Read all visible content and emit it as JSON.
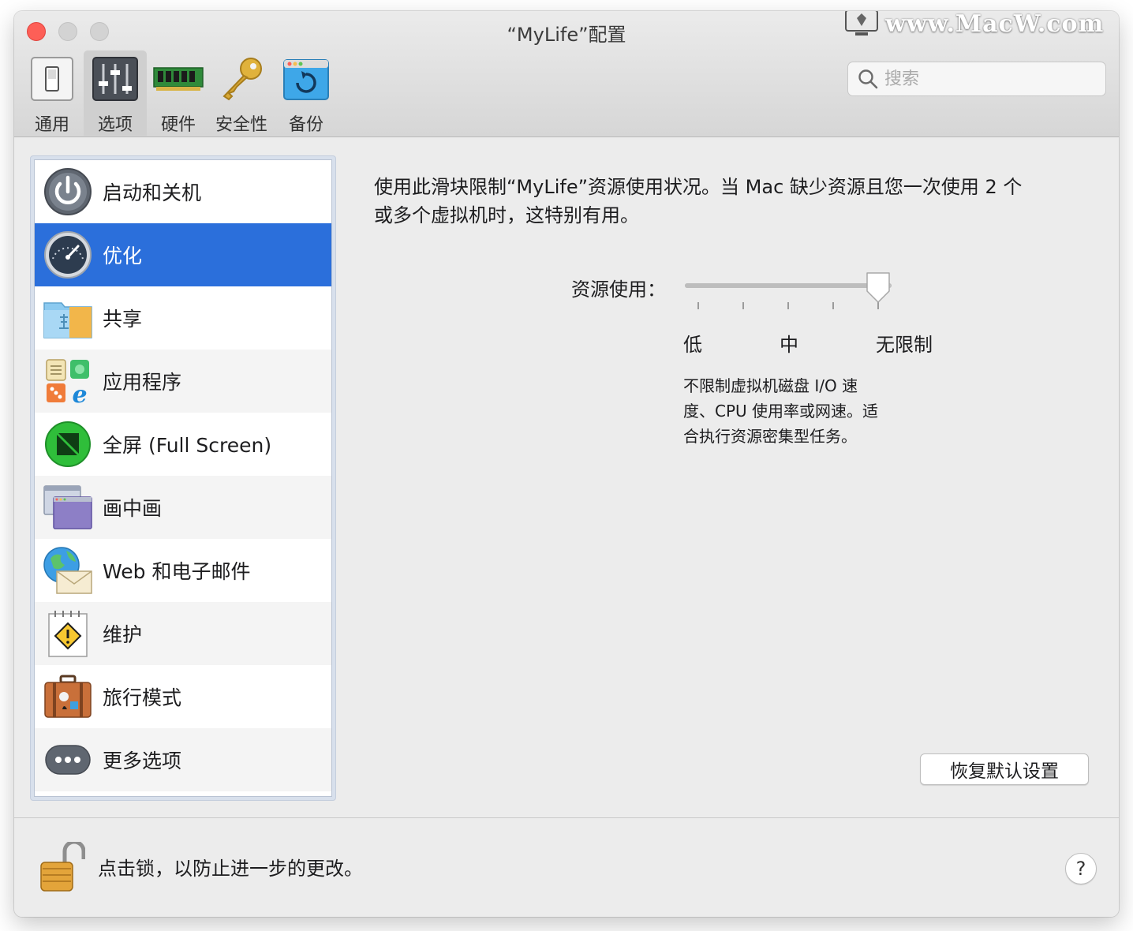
{
  "window": {
    "title": "“MyLife”配置",
    "watermark": "www.MacW.com"
  },
  "toolbar": {
    "items": [
      {
        "label": "通用",
        "icon": "switch-icon"
      },
      {
        "label": "选项",
        "icon": "sliders-icon"
      },
      {
        "label": "硬件",
        "icon": "memory-chip-icon"
      },
      {
        "label": "安全性",
        "icon": "key-icon"
      },
      {
        "label": "备份",
        "icon": "backup-icon"
      }
    ],
    "active": "选项"
  },
  "search": {
    "placeholder": "搜索",
    "value": ""
  },
  "sidebar": {
    "selected": "优化",
    "items": [
      {
        "label": "启动和关机",
        "icon": "power-icon"
      },
      {
        "label": "优化",
        "icon": "speedometer-icon"
      },
      {
        "label": "共享",
        "icon": "shared-folder-icon"
      },
      {
        "label": "应用程序",
        "icon": "applications-icon"
      },
      {
        "label": "全屏 (Full Screen)",
        "icon": "fullscreen-icon"
      },
      {
        "label": "画中画",
        "icon": "picture-in-picture-icon"
      },
      {
        "label": "Web 和电子邮件",
        "icon": "web-email-icon"
      },
      {
        "label": "维护",
        "icon": "maintenance-icon"
      },
      {
        "label": "旅行模式",
        "icon": "suitcase-icon"
      },
      {
        "label": "更多选项",
        "icon": "more-options-icon"
      }
    ]
  },
  "optimization": {
    "description_line1": "使用此滑块限制“MyLife”资源使用状况。当 Mac 缺少资源且您一次使用 2 个",
    "description_line2": "或多个虚拟机时，这特别有用。",
    "slider_label": "资源使用：",
    "slider_value": 1.0,
    "slider_ticks": 5,
    "scale_low": "低",
    "scale_mid": "中",
    "scale_high": "无限制",
    "scale_desc_line1": "不限制虚拟机磁盘 I/O 速",
    "scale_desc_line2": "度、CPU 使用率或网速。适",
    "scale_desc_line3": "合执行资源密集型任务。",
    "restore_button": "恢复默认设置"
  },
  "footer": {
    "lock_text": "点击锁，以防止进一步的更改。",
    "help_label": "?"
  },
  "colors": {
    "selection": "#2b6fdb",
    "close": "#fd5f57"
  }
}
